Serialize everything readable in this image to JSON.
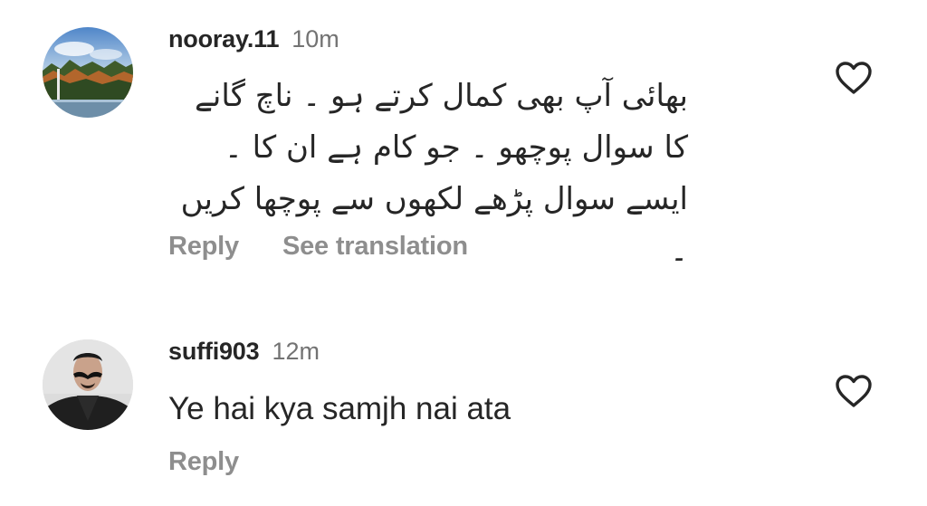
{
  "comments": [
    {
      "username": "nooray.11",
      "time": "10m",
      "text": "بھائی آپ بھی کمال کرتے ہو ۔ ناچ گانے کا سوال پوچھو ۔ جو کام ہے ان کا ۔ ایسے سوال پڑھے لکھوں سے پوچھا کریں ۔",
      "reply_label": "Reply",
      "translate_label": "See translation",
      "avatar_icon": "landscape-avatar",
      "like_icon": "heart-outline-icon"
    },
    {
      "username": "suffi903",
      "time": "12m",
      "text": "Ye hai kya samjh nai ata",
      "reply_label": "Reply",
      "avatar_icon": "masked-person-avatar",
      "like_icon": "heart-outline-icon"
    }
  ],
  "colors": {
    "primary_text": "#262626",
    "secondary_text": "#737373",
    "action_text": "#8e8e8e",
    "background": "#ffffff"
  }
}
